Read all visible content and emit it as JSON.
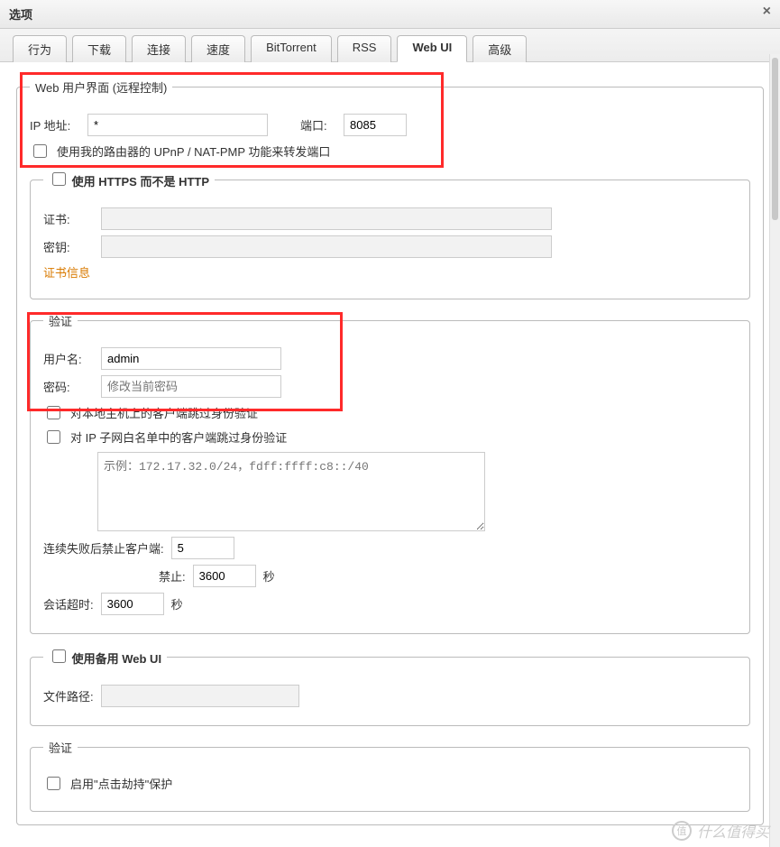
{
  "window": {
    "title": "选项"
  },
  "tabs": [
    "行为",
    "下载",
    "连接",
    "速度",
    "BitTorrent",
    "RSS",
    "Web UI",
    "高级"
  ],
  "active_tab": 6,
  "webui": {
    "legend": "Web 用户界面  (远程控制)",
    "ip_label": "IP 地址:",
    "ip_value": "*",
    "port_label": "端口:",
    "port_value": "8085",
    "upnp_label": "使用我的路由器的 UPnP / NAT-PMP 功能来转发端口"
  },
  "https": {
    "legend": "使用 HTTPS 而不是 HTTP",
    "cert_label": "证书:",
    "cert_value": "",
    "key_label": "密钥:",
    "key_value": "",
    "cert_info": "证书信息"
  },
  "auth": {
    "legend": "验证",
    "user_label": "用户名:",
    "user_value": "admin",
    "pass_label": "密码:",
    "pass_placeholder": "修改当前密码",
    "bypass_local": "对本地主机上的客户端跳过身份验证",
    "bypass_subnet": "对 IP 子网白名单中的客户端跳过身份验证",
    "subnet_placeholder": "示例：172.17.32.0/24，fdff:ffff:c8::/40",
    "ban_after_label": "连续失败后禁止客户端:",
    "ban_after_value": "5",
    "ban_for_label": "禁止:",
    "ban_for_value": "3600",
    "seconds": "秒",
    "session_label": "会话超时:",
    "session_value": "3600"
  },
  "altui": {
    "legend": "使用备用 Web UI",
    "path_label": "文件路径:",
    "path_value": ""
  },
  "auth2": {
    "legend": "验证",
    "clickjack": "启用\"点击劫持\"保护"
  },
  "watermark": "什么值得买"
}
